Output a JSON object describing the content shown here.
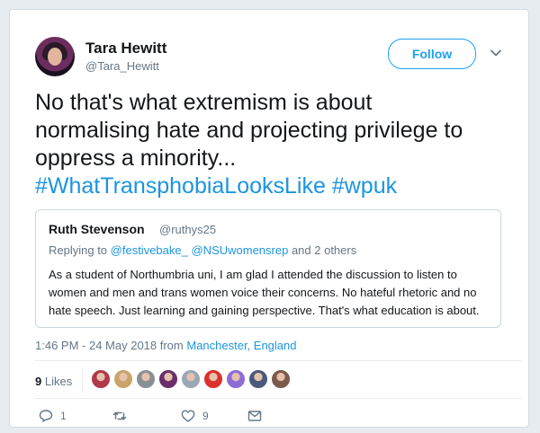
{
  "tweet": {
    "author_name": "Tara Hewitt",
    "author_handle": "@Tara_Hewitt",
    "follow_label": "Follow",
    "text_line1": "No that's what extremism is about",
    "text_line2": "normalising hate and projecting privilege to",
    "text_line3": "oppress a minority...",
    "hashtag1": "#WhatTransphobiaLooksLike",
    "hashtag2": "#wpuk",
    "timestamp": "1:46 PM - 24 May 2018 from ",
    "location": "Manchester, England"
  },
  "quoted": {
    "author_name": "Ruth Stevenson",
    "author_handle": "@ruthys25",
    "replying_prefix": "Replying to ",
    "reply_user1": "@festivebake_",
    "reply_user2": "@NSUwomensrep",
    "reply_suffix": " and 2 others",
    "body_line1": "As a student of Northumbria uni, I am glad I attended the discussion to listen to",
    "body_line2": "women and men and trans women voice their concerns. No hateful rhetoric and no",
    "body_line3": "hate speech. Just learning and gaining perspective. That's what education is about."
  },
  "engagement": {
    "likes_count": "9",
    "likes_label": " Likes",
    "liker_avatars": [
      {
        "name": "liker-avatar-1",
        "color": "#b03a4a"
      },
      {
        "name": "liker-avatar-2",
        "color": "#c9a36b"
      },
      {
        "name": "liker-avatar-3",
        "color": "#8a8f95"
      },
      {
        "name": "liker-avatar-4",
        "color": "#6a2f6b"
      },
      {
        "name": "liker-avatar-5",
        "color": "#9aa7b5"
      },
      {
        "name": "liker-avatar-6",
        "color": "#d9332b"
      },
      {
        "name": "liker-avatar-7",
        "color": "#8e6cd8"
      },
      {
        "name": "liker-avatar-8",
        "color": "#4a5a7a"
      },
      {
        "name": "liker-avatar-9",
        "color": "#7a5a4a"
      }
    ]
  },
  "actions": {
    "reply_count": "1",
    "retweet_count": "",
    "like_count": "9"
  },
  "colors": {
    "accent": "#1da1f2",
    "link": "#1b95e0",
    "muted": "#657786"
  }
}
